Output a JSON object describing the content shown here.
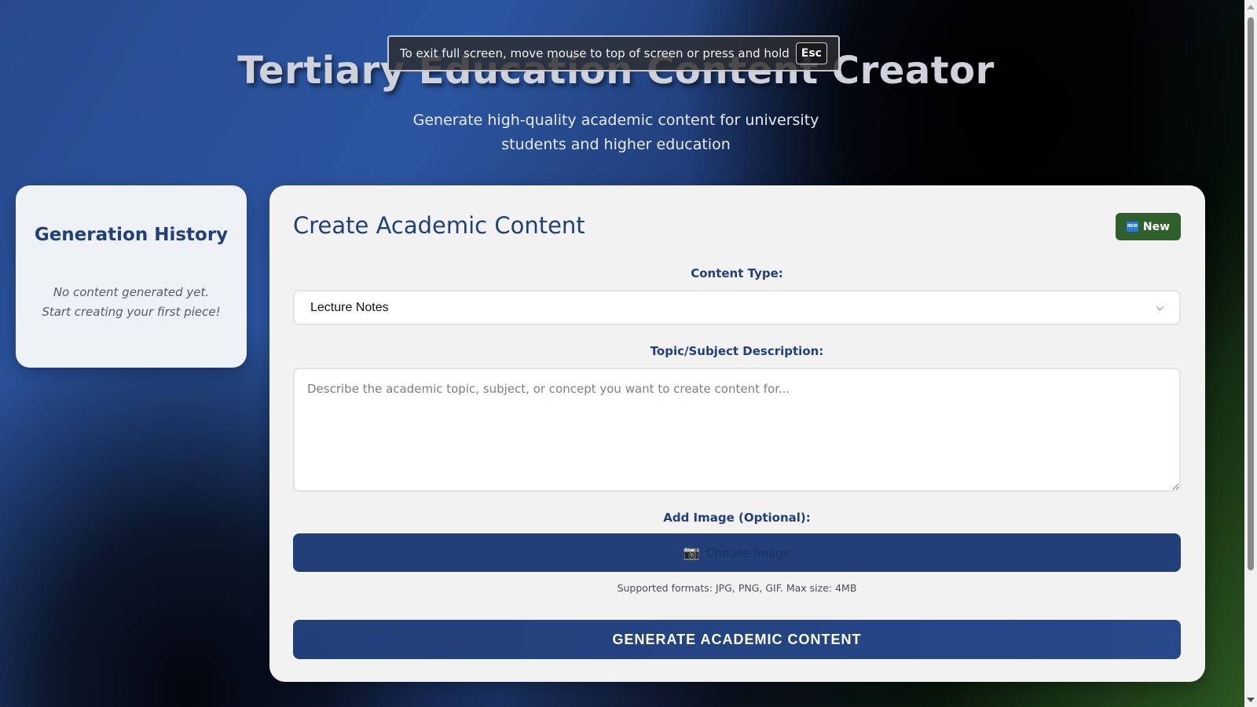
{
  "header": {
    "title": "Tertiary Education Content Creator",
    "subtitle": "Generate high-quality academic content for university students and higher education"
  },
  "fullscreen_toast": {
    "message": "To exit full screen, move mouse to top of screen or press and hold",
    "key": "Esc"
  },
  "history": {
    "title": "Generation History",
    "empty_line1": "No content generated yet.",
    "empty_line2": "Start creating your first piece!"
  },
  "main": {
    "title": "Create Academic Content",
    "new_button": {
      "badge": "NEW",
      "label": "New",
      "icon": "new-badge-icon",
      "color": "#2f5f2b"
    },
    "content_type": {
      "label": "Content Type:",
      "selected": "Lecture Notes"
    },
    "topic": {
      "label": "Topic/Subject Description:",
      "value": "",
      "placeholder": "Describe the academic topic, subject, or concept you want to create content for..."
    },
    "image": {
      "label": "Add Image (Optional):",
      "button_label": "Choose Image",
      "icon": "camera-icon",
      "note": "Supported formats: JPG, PNG, GIF. Max size: 4MB"
    },
    "generate_label": "GENERATE ACADEMIC CONTENT"
  },
  "colors": {
    "accent": "#21407a",
    "button": "#223f79",
    "new_button": "#2f5f2b"
  }
}
